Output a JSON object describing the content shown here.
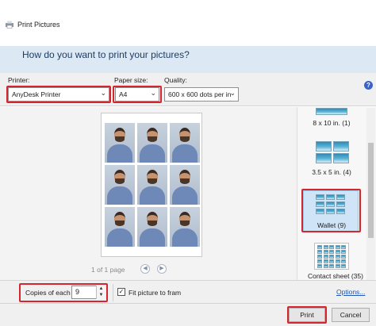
{
  "window": {
    "title": "Print Pictures"
  },
  "header": {
    "question": "How do you want to print your pictures?"
  },
  "printer": {
    "label": "Printer:",
    "value": "AnyDesk Printer"
  },
  "paper_size": {
    "label": "Paper size:",
    "value": "A4"
  },
  "quality": {
    "label": "Quality:",
    "value": "600 x 600 dots per in"
  },
  "preview": {
    "page_indicator": "1 of 1 page",
    "prev_glyph": "◀",
    "next_glyph": "▶"
  },
  "layouts": [
    {
      "label": "8 x 10 in. (1)"
    },
    {
      "label": "3.5 x 5 in. (4)"
    },
    {
      "label": "Wallet (9)",
      "selected": true
    },
    {
      "label": "Contact sheet (35)"
    }
  ],
  "copies": {
    "label": "Copies of each",
    "value": "9",
    "up": "▲",
    "down": "▼"
  },
  "fit": {
    "label": "Fit picture to fram",
    "checked": true,
    "mark": "✓"
  },
  "options_link": "Options...",
  "buttons": {
    "print": "Print",
    "cancel": "Cancel"
  },
  "icons": {
    "app": "printer-icon",
    "help": "help-icon",
    "help_glyph": "?",
    "dropdown": "⌄"
  },
  "colors": {
    "highlight": "#d6262d",
    "header_band": "#dde8f5",
    "selected_layout": "#cfe5f7"
  }
}
